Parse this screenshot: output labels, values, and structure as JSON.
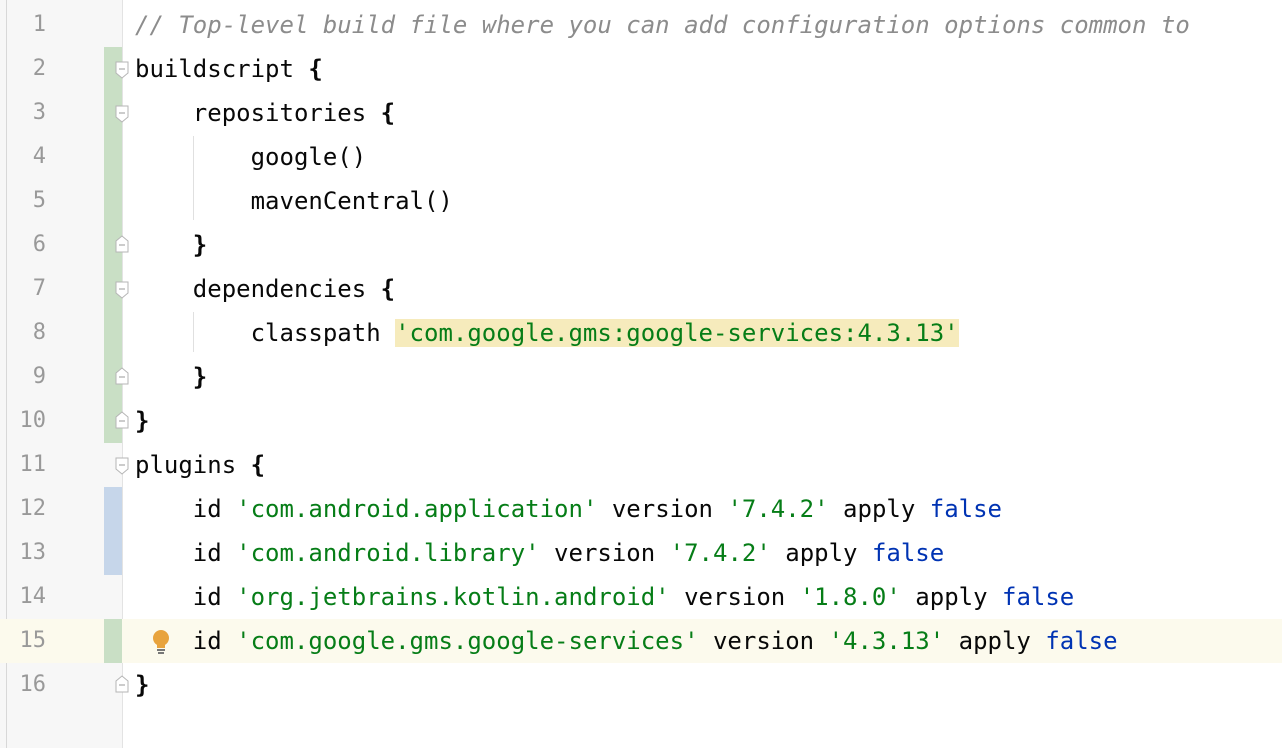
{
  "editor": {
    "current_line": 15,
    "lines": [
      {
        "num": "1",
        "tokens": [
          {
            "t": "// Top-level build file where you can add configuration options common to",
            "c": "cmt"
          }
        ]
      },
      {
        "num": "2",
        "tokens": [
          {
            "t": "buildscript ",
            "c": ""
          },
          {
            "t": "{",
            "c": "br"
          }
        ]
      },
      {
        "num": "3",
        "tokens": [
          {
            "t": "    repositories ",
            "c": ""
          },
          {
            "t": "{",
            "c": "br"
          }
        ]
      },
      {
        "num": "4",
        "tokens": [
          {
            "t": "        google()",
            "c": ""
          }
        ]
      },
      {
        "num": "5",
        "tokens": [
          {
            "t": "        mavenCentral()",
            "c": ""
          }
        ]
      },
      {
        "num": "6",
        "tokens": [
          {
            "t": "    ",
            "c": ""
          },
          {
            "t": "}",
            "c": "br"
          }
        ]
      },
      {
        "num": "7",
        "tokens": [
          {
            "t": "    dependencies ",
            "c": ""
          },
          {
            "t": "{",
            "c": "br"
          }
        ]
      },
      {
        "num": "8",
        "tokens": [
          {
            "t": "        classpath ",
            "c": ""
          },
          {
            "t": "'com.google.gms:google-services:4.3.13'",
            "c": "str hl"
          }
        ]
      },
      {
        "num": "9",
        "tokens": [
          {
            "t": "    ",
            "c": ""
          },
          {
            "t": "}",
            "c": "br"
          }
        ]
      },
      {
        "num": "10",
        "tokens": [
          {
            "t": "}",
            "c": "br"
          }
        ]
      },
      {
        "num": "11",
        "tokens": [
          {
            "t": "plugins ",
            "c": ""
          },
          {
            "t": "{",
            "c": "br"
          }
        ]
      },
      {
        "num": "12",
        "tokens": [
          {
            "t": "    id ",
            "c": ""
          },
          {
            "t": "'com.android.application'",
            "c": "str"
          },
          {
            "t": " version ",
            "c": ""
          },
          {
            "t": "'7.4.2'",
            "c": "str"
          },
          {
            "t": " apply ",
            "c": ""
          },
          {
            "t": "false",
            "c": "kw"
          }
        ]
      },
      {
        "num": "13",
        "tokens": [
          {
            "t": "    id ",
            "c": ""
          },
          {
            "t": "'com.android.library'",
            "c": "str"
          },
          {
            "t": " version ",
            "c": ""
          },
          {
            "t": "'7.4.2'",
            "c": "str"
          },
          {
            "t": " apply ",
            "c": ""
          },
          {
            "t": "false",
            "c": "kw"
          }
        ]
      },
      {
        "num": "14",
        "tokens": [
          {
            "t": "    id ",
            "c": ""
          },
          {
            "t": "'org.jetbrains.kotlin.android'",
            "c": "str"
          },
          {
            "t": " version ",
            "c": ""
          },
          {
            "t": "'1.8.0'",
            "c": "str"
          },
          {
            "t": " apply ",
            "c": ""
          },
          {
            "t": "false",
            "c": "kw"
          }
        ]
      },
      {
        "num": "15",
        "tokens": [
          {
            "t": "    id ",
            "c": ""
          },
          {
            "t": "'com.google.gms.google-services'",
            "c": "str"
          },
          {
            "t": " version ",
            "c": ""
          },
          {
            "t": "'4.3.13'",
            "c": "str"
          },
          {
            "t": " apply ",
            "c": ""
          },
          {
            "t": "false",
            "c": "kw"
          }
        ]
      },
      {
        "num": "16",
        "tokens": [
          {
            "t": "}",
            "c": "br"
          }
        ]
      }
    ],
    "gutter": {
      "modified_lines": [
        2,
        3,
        4,
        5,
        6,
        7,
        8,
        9,
        10,
        15
      ],
      "added_lines": [
        12,
        13
      ],
      "fold_open_lines": [
        2,
        3,
        7,
        11
      ],
      "fold_close_lines": [
        6,
        9,
        10,
        16
      ],
      "intention_icon": "lightbulb-icon",
      "intention_line": 15
    },
    "colors": {
      "comment": "#8c8c8c",
      "keyword": "#0033b3",
      "string": "#067d17",
      "modified_marker": "#c9dfc5",
      "added_marker": "#c6d6ea",
      "current_line_bg": "#fcfaed",
      "match_highlight": "#f6ebbc",
      "bulb": "#e8a33d"
    }
  }
}
